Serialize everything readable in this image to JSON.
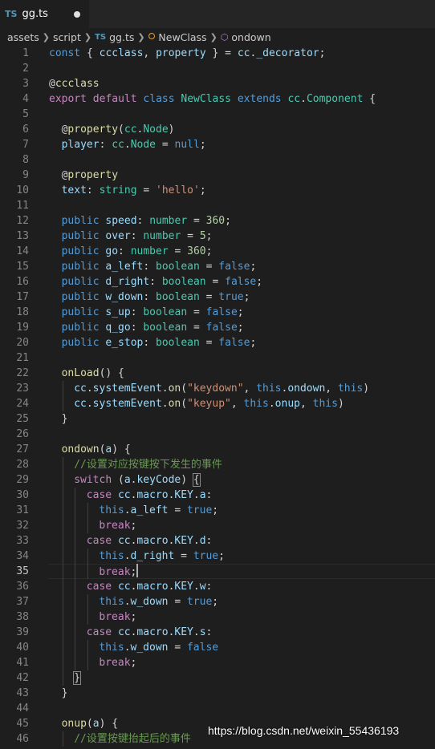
{
  "tab": {
    "icon": "TS",
    "filename": "gg.ts",
    "modified_indicator": "unsaved-dot"
  },
  "breadcrumb": {
    "items": [
      "assets",
      "script",
      "gg.ts",
      "NewClass",
      "ondown"
    ],
    "ts_icon": "TS",
    "icons": [
      "chevron-right-icon",
      "typescript-file-icon",
      "class-icon",
      "method-cube-icon"
    ]
  },
  "editor": {
    "current_line": 35,
    "colors": {
      "keyword": "#569cd6",
      "control": "#c586c0",
      "variable": "#9cdcfe",
      "type": "#4ec9b0",
      "function": "#dcdcaa",
      "string": "#ce9178",
      "number": "#b5cea8",
      "comment": "#6a9955",
      "plain": "#d4d4d4"
    },
    "lines": [
      {
        "n": "1",
        "indent": 0,
        "tokens": [
          [
            "kw",
            "const"
          ],
          [
            "p",
            " { "
          ],
          [
            "var",
            "ccclass"
          ],
          [
            "p",
            ", "
          ],
          [
            "var",
            "property"
          ],
          [
            "p",
            " } = "
          ],
          [
            "var",
            "cc"
          ],
          [
            "p",
            "."
          ],
          [
            "var",
            "_decorator"
          ],
          [
            "p",
            ";"
          ]
        ]
      },
      {
        "n": "2",
        "indent": 0,
        "tokens": []
      },
      {
        "n": "3",
        "indent": 0,
        "tokens": [
          [
            "p",
            "@"
          ],
          [
            "fn",
            "ccclass"
          ]
        ]
      },
      {
        "n": "4",
        "indent": 0,
        "tokens": [
          [
            "ctrl",
            "export"
          ],
          [
            "p",
            " "
          ],
          [
            "ctrl",
            "default"
          ],
          [
            "p",
            " "
          ],
          [
            "kw",
            "class"
          ],
          [
            "p",
            " "
          ],
          [
            "type",
            "NewClass"
          ],
          [
            "p",
            " "
          ],
          [
            "kw",
            "extends"
          ],
          [
            "p",
            " "
          ],
          [
            "type",
            "cc"
          ],
          [
            "p",
            "."
          ],
          [
            "type",
            "Component"
          ],
          [
            "p",
            " {"
          ]
        ]
      },
      {
        "n": "5",
        "indent": 0,
        "tokens": []
      },
      {
        "n": "6",
        "indent": 1,
        "tokens": [
          [
            "p",
            "@"
          ],
          [
            "fn",
            "property"
          ],
          [
            "p",
            "("
          ],
          [
            "type",
            "cc"
          ],
          [
            "p",
            "."
          ],
          [
            "type",
            "Node"
          ],
          [
            "p",
            ")"
          ]
        ]
      },
      {
        "n": "7",
        "indent": 1,
        "tokens": [
          [
            "var",
            "player"
          ],
          [
            "p",
            ": "
          ],
          [
            "type",
            "cc"
          ],
          [
            "p",
            "."
          ],
          [
            "type",
            "Node"
          ],
          [
            "p",
            " = "
          ],
          [
            "kw",
            "null"
          ],
          [
            "p",
            ";"
          ]
        ]
      },
      {
        "n": "8",
        "indent": 1,
        "tokens": []
      },
      {
        "n": "9",
        "indent": 1,
        "tokens": [
          [
            "p",
            "@"
          ],
          [
            "fn",
            "property"
          ]
        ]
      },
      {
        "n": "10",
        "indent": 1,
        "tokens": [
          [
            "var",
            "text"
          ],
          [
            "p",
            ": "
          ],
          [
            "type",
            "string"
          ],
          [
            "p",
            " = "
          ],
          [
            "str",
            "'hello'"
          ],
          [
            "p",
            ";"
          ]
        ]
      },
      {
        "n": "11",
        "indent": 1,
        "tokens": []
      },
      {
        "n": "12",
        "indent": 1,
        "tokens": [
          [
            "kw",
            "public"
          ],
          [
            "p",
            " "
          ],
          [
            "var",
            "speed"
          ],
          [
            "p",
            ": "
          ],
          [
            "type",
            "number"
          ],
          [
            "p",
            " = "
          ],
          [
            "num",
            "360"
          ],
          [
            "p",
            ";"
          ]
        ]
      },
      {
        "n": "13",
        "indent": 1,
        "tokens": [
          [
            "kw",
            "public"
          ],
          [
            "p",
            " "
          ],
          [
            "var",
            "over"
          ],
          [
            "p",
            ": "
          ],
          [
            "type",
            "number"
          ],
          [
            "p",
            " = "
          ],
          [
            "num",
            "5"
          ],
          [
            "p",
            ";"
          ]
        ]
      },
      {
        "n": "14",
        "indent": 1,
        "tokens": [
          [
            "kw",
            "public"
          ],
          [
            "p",
            " "
          ],
          [
            "var",
            "go"
          ],
          [
            "p",
            ": "
          ],
          [
            "type",
            "number"
          ],
          [
            "p",
            " = "
          ],
          [
            "num",
            "360"
          ],
          [
            "p",
            ";"
          ]
        ]
      },
      {
        "n": "15",
        "indent": 1,
        "tokens": [
          [
            "kw",
            "public"
          ],
          [
            "p",
            " "
          ],
          [
            "var",
            "a_left"
          ],
          [
            "p",
            ": "
          ],
          [
            "type",
            "boolean"
          ],
          [
            "p",
            " = "
          ],
          [
            "kw",
            "false"
          ],
          [
            "p",
            ";"
          ]
        ]
      },
      {
        "n": "16",
        "indent": 1,
        "tokens": [
          [
            "kw",
            "public"
          ],
          [
            "p",
            " "
          ],
          [
            "var",
            "d_right"
          ],
          [
            "p",
            ": "
          ],
          [
            "type",
            "boolean"
          ],
          [
            "p",
            " = "
          ],
          [
            "kw",
            "false"
          ],
          [
            "p",
            ";"
          ]
        ]
      },
      {
        "n": "17",
        "indent": 1,
        "tokens": [
          [
            "kw",
            "public"
          ],
          [
            "p",
            " "
          ],
          [
            "var",
            "w_down"
          ],
          [
            "p",
            ": "
          ],
          [
            "type",
            "boolean"
          ],
          [
            "p",
            " = "
          ],
          [
            "kw",
            "true"
          ],
          [
            "p",
            ";"
          ]
        ]
      },
      {
        "n": "18",
        "indent": 1,
        "tokens": [
          [
            "kw",
            "public"
          ],
          [
            "p",
            " "
          ],
          [
            "var",
            "s_up"
          ],
          [
            "p",
            ": "
          ],
          [
            "type",
            "boolean"
          ],
          [
            "p",
            " = "
          ],
          [
            "kw",
            "false"
          ],
          [
            "p",
            ";"
          ]
        ]
      },
      {
        "n": "19",
        "indent": 1,
        "tokens": [
          [
            "kw",
            "public"
          ],
          [
            "p",
            " "
          ],
          [
            "var",
            "q_go"
          ],
          [
            "p",
            ": "
          ],
          [
            "type",
            "boolean"
          ],
          [
            "p",
            " = "
          ],
          [
            "kw",
            "false"
          ],
          [
            "p",
            ";"
          ]
        ]
      },
      {
        "n": "20",
        "indent": 1,
        "tokens": [
          [
            "kw",
            "public"
          ],
          [
            "p",
            " "
          ],
          [
            "var",
            "e_stop"
          ],
          [
            "p",
            ": "
          ],
          [
            "type",
            "boolean"
          ],
          [
            "p",
            " = "
          ],
          [
            "kw",
            "false"
          ],
          [
            "p",
            ";"
          ]
        ]
      },
      {
        "n": "21",
        "indent": 1,
        "tokens": []
      },
      {
        "n": "22",
        "indent": 1,
        "tokens": [
          [
            "fn",
            "onLoad"
          ],
          [
            "p",
            "() {"
          ]
        ]
      },
      {
        "n": "23",
        "indent": 2,
        "tokens": [
          [
            "var",
            "cc"
          ],
          [
            "p",
            "."
          ],
          [
            "var",
            "systemEvent"
          ],
          [
            "p",
            "."
          ],
          [
            "fn",
            "on"
          ],
          [
            "p",
            "("
          ],
          [
            "str",
            "\"keydown\""
          ],
          [
            "p",
            ", "
          ],
          [
            "kw",
            "this"
          ],
          [
            "p",
            "."
          ],
          [
            "var",
            "ondown"
          ],
          [
            "p",
            ", "
          ],
          [
            "kw",
            "this"
          ],
          [
            "p",
            ")"
          ]
        ]
      },
      {
        "n": "24",
        "indent": 2,
        "tokens": [
          [
            "var",
            "cc"
          ],
          [
            "p",
            "."
          ],
          [
            "var",
            "systemEvent"
          ],
          [
            "p",
            "."
          ],
          [
            "fn",
            "on"
          ],
          [
            "p",
            "("
          ],
          [
            "str",
            "\"keyup\""
          ],
          [
            "p",
            ", "
          ],
          [
            "kw",
            "this"
          ],
          [
            "p",
            "."
          ],
          [
            "var",
            "onup"
          ],
          [
            "p",
            ", "
          ],
          [
            "kw",
            "this"
          ],
          [
            "p",
            ")"
          ]
        ]
      },
      {
        "n": "25",
        "indent": 1,
        "tokens": [
          [
            "p",
            "}"
          ]
        ]
      },
      {
        "n": "26",
        "indent": 1,
        "tokens": []
      },
      {
        "n": "27",
        "indent": 1,
        "tokens": [
          [
            "fn",
            "ondown"
          ],
          [
            "p",
            "("
          ],
          [
            "var",
            "a"
          ],
          [
            "p",
            ") {"
          ]
        ]
      },
      {
        "n": "28",
        "indent": 2,
        "tokens": [
          [
            "cmt",
            "//设置对应按键按下发生的事件"
          ]
        ]
      },
      {
        "n": "29",
        "indent": 2,
        "tokens": [
          [
            "ctrl",
            "switch"
          ],
          [
            "p",
            " ("
          ],
          [
            "var",
            "a"
          ],
          [
            "p",
            "."
          ],
          [
            "var",
            "keyCode"
          ],
          [
            "p",
            ") "
          ],
          [
            "box",
            "{"
          ]
        ]
      },
      {
        "n": "30",
        "indent": 3,
        "tokens": [
          [
            "ctrl",
            "case"
          ],
          [
            "p",
            " "
          ],
          [
            "var",
            "cc"
          ],
          [
            "p",
            "."
          ],
          [
            "var",
            "macro"
          ],
          [
            "p",
            "."
          ],
          [
            "var",
            "KEY"
          ],
          [
            "p",
            "."
          ],
          [
            "var",
            "a"
          ],
          [
            "p",
            ":"
          ]
        ]
      },
      {
        "n": "31",
        "indent": 4,
        "tokens": [
          [
            "kw",
            "this"
          ],
          [
            "p",
            "."
          ],
          [
            "var",
            "a_left"
          ],
          [
            "p",
            " = "
          ],
          [
            "kw",
            "true"
          ],
          [
            "p",
            ";"
          ]
        ]
      },
      {
        "n": "32",
        "indent": 4,
        "tokens": [
          [
            "ctrl",
            "break"
          ],
          [
            "p",
            ";"
          ]
        ]
      },
      {
        "n": "33",
        "indent": 3,
        "tokens": [
          [
            "ctrl",
            "case"
          ],
          [
            "p",
            " "
          ],
          [
            "var",
            "cc"
          ],
          [
            "p",
            "."
          ],
          [
            "var",
            "macro"
          ],
          [
            "p",
            "."
          ],
          [
            "var",
            "KEY"
          ],
          [
            "p",
            "."
          ],
          [
            "var",
            "d"
          ],
          [
            "p",
            ":"
          ]
        ]
      },
      {
        "n": "34",
        "indent": 4,
        "tokens": [
          [
            "kw",
            "this"
          ],
          [
            "p",
            "."
          ],
          [
            "var",
            "d_right"
          ],
          [
            "p",
            " = "
          ],
          [
            "kw",
            "true"
          ],
          [
            "p",
            ";"
          ]
        ]
      },
      {
        "n": "35",
        "indent": 4,
        "tokens": [
          [
            "ctrl",
            "break"
          ],
          [
            "p",
            ";"
          ],
          [
            "cursor",
            ""
          ]
        ]
      },
      {
        "n": "36",
        "indent": 3,
        "tokens": [
          [
            "ctrl",
            "case"
          ],
          [
            "p",
            " "
          ],
          [
            "var",
            "cc"
          ],
          [
            "p",
            "."
          ],
          [
            "var",
            "macro"
          ],
          [
            "p",
            "."
          ],
          [
            "var",
            "KEY"
          ],
          [
            "p",
            "."
          ],
          [
            "var",
            "w"
          ],
          [
            "p",
            ":"
          ]
        ]
      },
      {
        "n": "37",
        "indent": 4,
        "tokens": [
          [
            "kw",
            "this"
          ],
          [
            "p",
            "."
          ],
          [
            "var",
            "w_down"
          ],
          [
            "p",
            " = "
          ],
          [
            "kw",
            "true"
          ],
          [
            "p",
            ";"
          ]
        ]
      },
      {
        "n": "38",
        "indent": 4,
        "tokens": [
          [
            "ctrl",
            "break"
          ],
          [
            "p",
            ";"
          ]
        ]
      },
      {
        "n": "39",
        "indent": 3,
        "tokens": [
          [
            "ctrl",
            "case"
          ],
          [
            "p",
            " "
          ],
          [
            "var",
            "cc"
          ],
          [
            "p",
            "."
          ],
          [
            "var",
            "macro"
          ],
          [
            "p",
            "."
          ],
          [
            "var",
            "KEY"
          ],
          [
            "p",
            "."
          ],
          [
            "var",
            "s"
          ],
          [
            "p",
            ":"
          ]
        ]
      },
      {
        "n": "40",
        "indent": 4,
        "tokens": [
          [
            "kw",
            "this"
          ],
          [
            "p",
            "."
          ],
          [
            "var",
            "w_down"
          ],
          [
            "p",
            " = "
          ],
          [
            "kw",
            "false"
          ]
        ]
      },
      {
        "n": "41",
        "indent": 4,
        "tokens": [
          [
            "ctrl",
            "break"
          ],
          [
            "p",
            ";"
          ]
        ]
      },
      {
        "n": "42",
        "indent": 2,
        "tokens": [
          [
            "box",
            "}"
          ]
        ]
      },
      {
        "n": "43",
        "indent": 1,
        "tokens": [
          [
            "p",
            "}"
          ]
        ]
      },
      {
        "n": "44",
        "indent": 1,
        "tokens": []
      },
      {
        "n": "45",
        "indent": 1,
        "tokens": [
          [
            "fn",
            "onup"
          ],
          [
            "p",
            "("
          ],
          [
            "var",
            "a"
          ],
          [
            "p",
            ") {"
          ]
        ]
      },
      {
        "n": "46",
        "indent": 2,
        "tokens": [
          [
            "cmt",
            "//设置按键抬起后的事件"
          ]
        ]
      }
    ]
  },
  "watermark": "https://blog.csdn.net/weixin_55436193"
}
